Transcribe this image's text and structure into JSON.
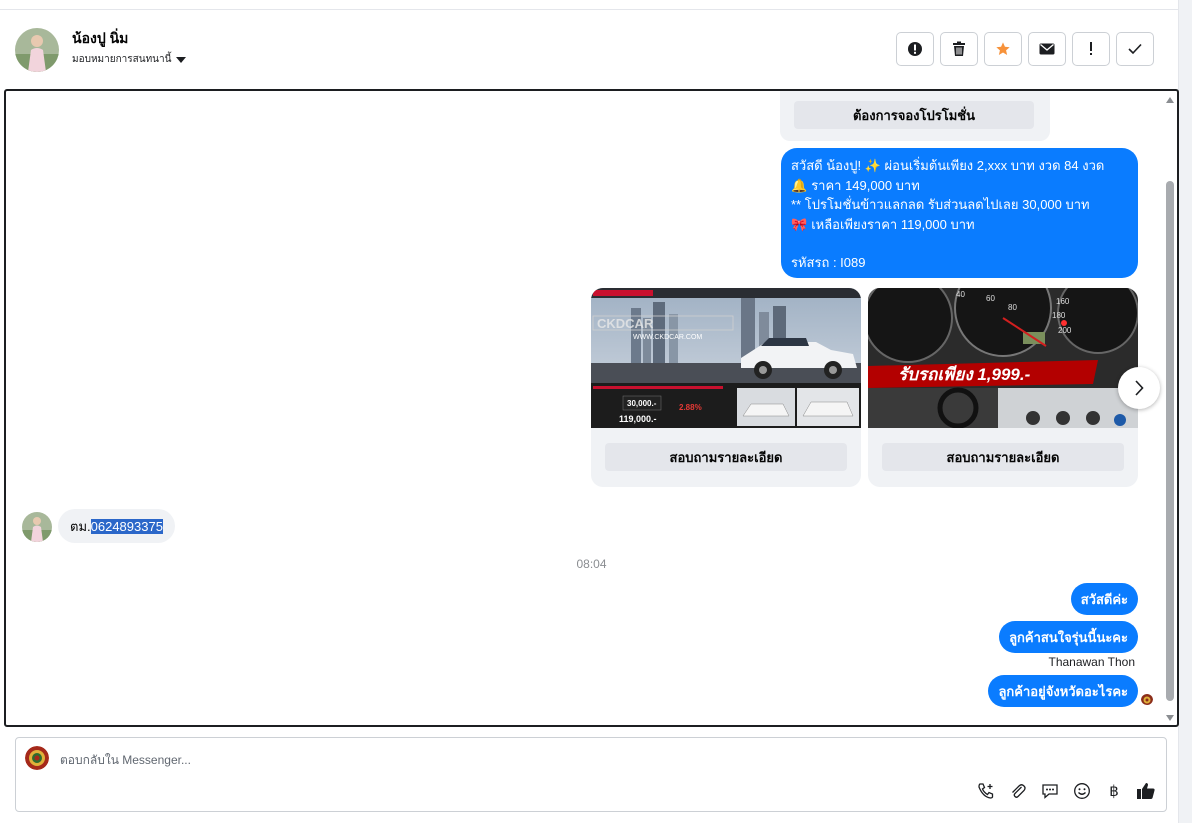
{
  "header": {
    "contact_name": "น้องปู นิ่ม",
    "assign_label": "มอบหมายการสนทนานี้",
    "actions": [
      {
        "name": "report-spam",
        "icon": "alert-circle-icon"
      },
      {
        "name": "delete",
        "icon": "trash-icon"
      },
      {
        "name": "star",
        "icon": "star-icon"
      },
      {
        "name": "mark-unread",
        "icon": "envelope-icon"
      },
      {
        "name": "follow-up",
        "icon": "exclamation-icon"
      },
      {
        "name": "mark-done",
        "icon": "check-icon"
      }
    ]
  },
  "conversation": {
    "quick_reply_button": "ต้องการจองโปรโมชั่น",
    "promo_message": {
      "line1": "สวัสดี น้องปู! ✨  ผ่อนเริ่มต้นเพียง 2,xxx บาท งวด 84 งวด",
      "line2_icon": "🔔",
      "line2": "ราคา 149,000 บาท",
      "line3": "** โปรโมชั่นข้าวแลกลด รับส่วนลดไปเลย 30,000 บาท",
      "line4_icon": "🎀",
      "line4": " เหลือเพียงราคา 119,000 บาท",
      "line5": "รหัสรถ : I089"
    },
    "cards": [
      {
        "button": "สอบถามรายละเอียด",
        "image": {
          "brand": "CKDCAR",
          "website": "WWW.CKDCAR.COM",
          "price1": "30,000.-",
          "price2": "119,000.-",
          "rate": "2.88%"
        }
      },
      {
        "button": "สอบถามรายละเอียด",
        "image": {
          "promo": "รับรถเพียง 1,999.-",
          "gauge_ticks": [
            "40",
            "60",
            "80",
            "160",
            "180",
            "200"
          ]
        }
      }
    ],
    "incoming_message": {
      "prefix": "ตม.",
      "selected": "0624893375"
    },
    "timestamp": "08:04",
    "outgoing_messages": [
      "สวัสดีค่ะ",
      "ลูกค้าสนใจรุ่นนี้นะคะ",
      "ลูกค้าอยู่จังหวัดอะไรคะ"
    ],
    "sender_name": "Thanawan Thon"
  },
  "composer": {
    "placeholder": "ตอบกลับใน Messenger...",
    "tools": [
      "call-add-icon",
      "paperclip-icon",
      "saved-reply-icon",
      "emoji-icon",
      "baht-icon",
      "thumbs-up-icon"
    ],
    "baht_symbol": "฿"
  },
  "colors": {
    "messenger_blue": "#0a7cff",
    "star_orange": "#f7923a",
    "selection": "#2b67c9"
  }
}
